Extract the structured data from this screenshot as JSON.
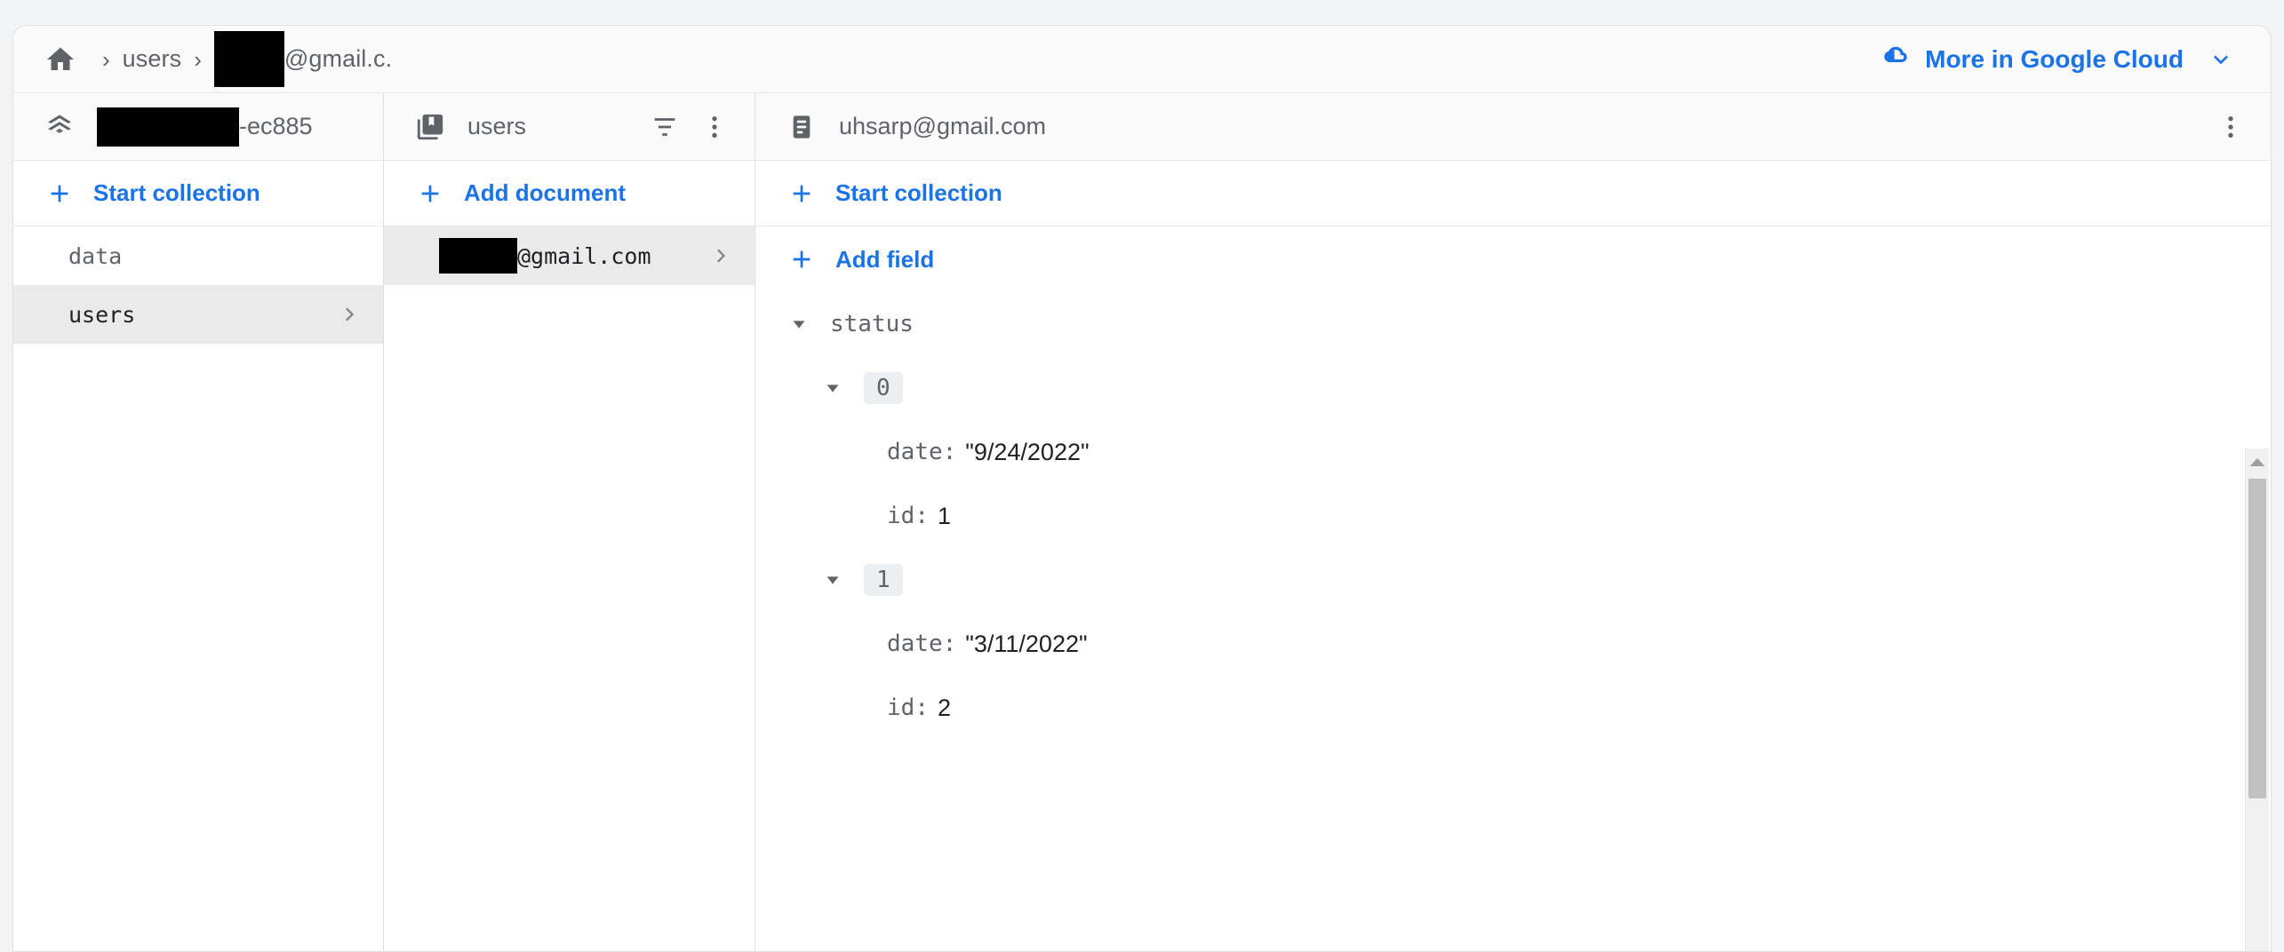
{
  "breadcrumb": {
    "home_icon": "home-icon",
    "separator": "›",
    "items": [
      "users"
    ],
    "current_prefix_redacted": true,
    "current_suffix": "@gmail.c."
  },
  "header": {
    "cloud_link_label": "More in Google Cloud",
    "cloud_icon": "google-cloud-icon",
    "chevron_icon": "chevron-down-icon"
  },
  "colors": {
    "accent_blue": "#1a73e8",
    "text_gray": "#5f6368",
    "text_dark": "#202124",
    "selected_row": "#eaeaea",
    "panel_head_bg": "#fafafa"
  },
  "panels": {
    "collections": {
      "icon": "project-layers-icon",
      "title_suffix": "-ec885",
      "title_redacted": true,
      "action_label": "Start collection",
      "items": [
        {
          "name": "data",
          "selected": false,
          "has_chevron": false
        },
        {
          "name": "users",
          "selected": true,
          "has_chevron": true
        }
      ]
    },
    "documents": {
      "icon": "collections-bookmark-icon",
      "title": "users",
      "filter_icon": "filter-icon",
      "more_icon": "more-vert-icon",
      "action_label": "Add document",
      "items": [
        {
          "name_suffix": "@gmail.com",
          "name_redacted": true,
          "selected": true,
          "has_chevron": true
        }
      ]
    },
    "document_detail": {
      "icon": "document-icon",
      "title": "uhsarp@gmail.com",
      "more_icon": "more-vert-icon",
      "start_collection_label": "Start collection",
      "add_field_label": "Add field",
      "fields": [
        {
          "key": "status",
          "level": 0,
          "expanded": true,
          "type": "array",
          "caret": "caret-down-icon"
        },
        {
          "index": "0",
          "level": 1,
          "expanded": true,
          "caret": "caret-down-icon"
        },
        {
          "key": "date",
          "value": "\"9/24/2022\"",
          "level": 2
        },
        {
          "key": "id",
          "value": "1",
          "level": 2
        },
        {
          "index": "1",
          "level": 1,
          "expanded": true,
          "caret": "caret-down-icon"
        },
        {
          "key": "date",
          "value": "\"3/11/2022\"",
          "level": 2
        },
        {
          "key": "id",
          "value": "2",
          "level": 2
        }
      ],
      "scrollbar": {
        "up_arrow_icon": "scroll-up-arrow-icon",
        "visible": true
      }
    }
  }
}
